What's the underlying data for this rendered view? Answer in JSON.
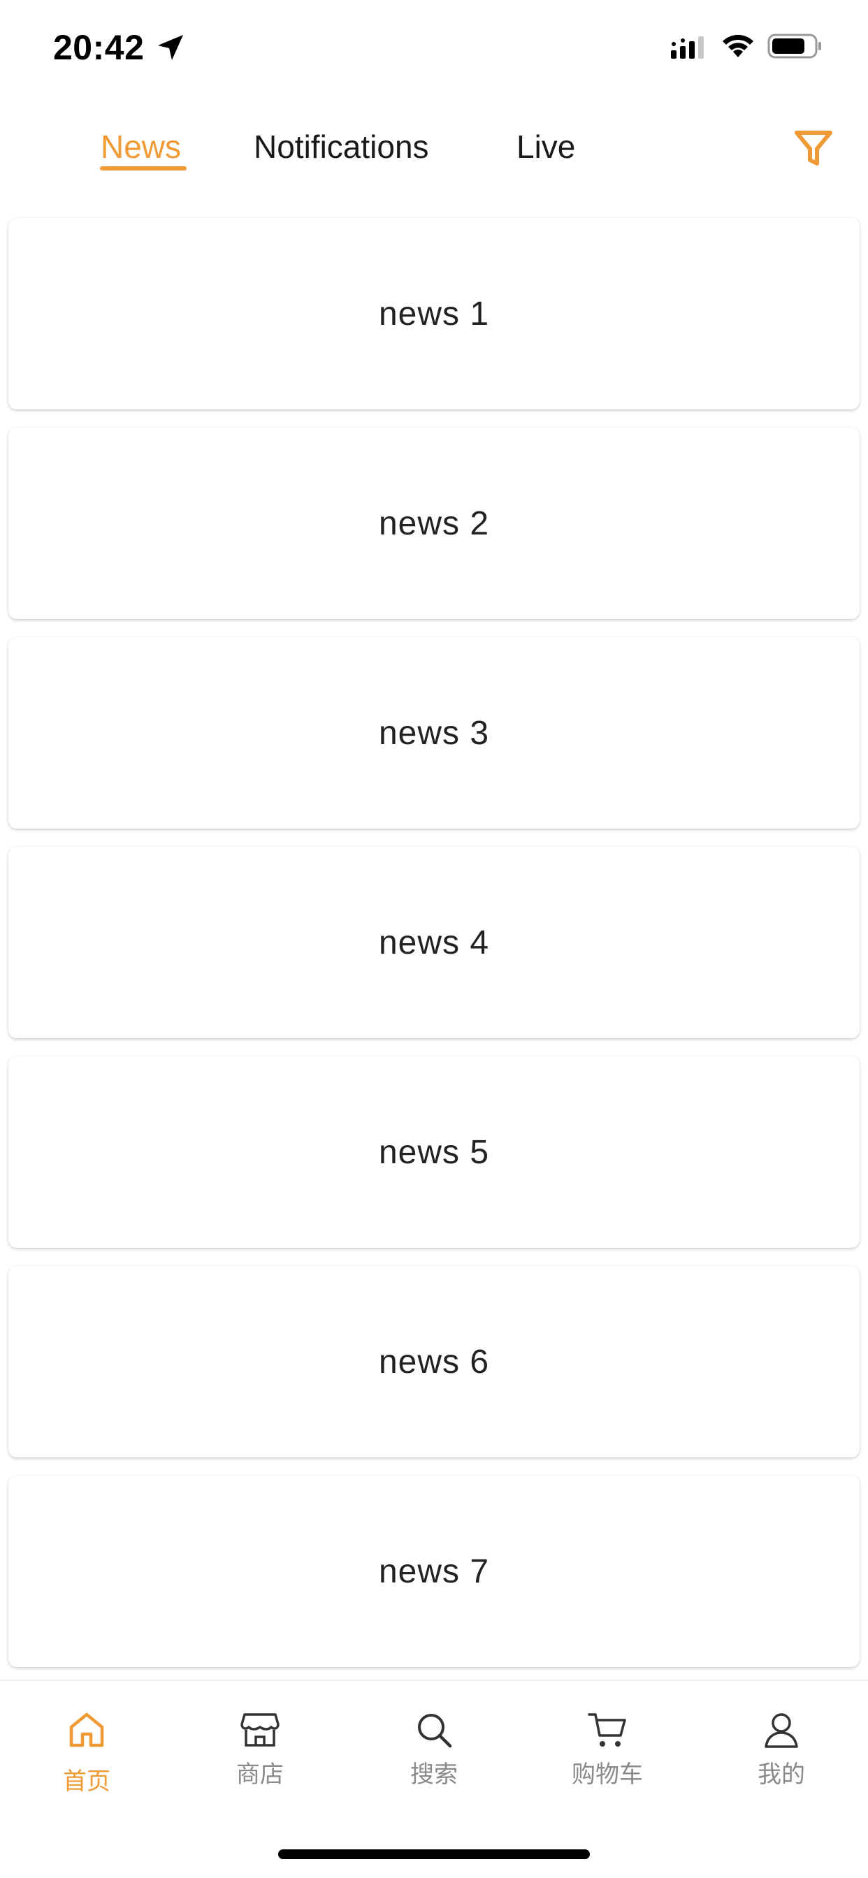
{
  "status_bar": {
    "time": "20:42",
    "icons": [
      "location-arrow-icon",
      "cellular-signal-icon",
      "wifi-icon",
      "battery-icon"
    ]
  },
  "tabs": [
    {
      "label": "News",
      "active": true
    },
    {
      "label": "Notifications",
      "active": false
    },
    {
      "label": "Live",
      "active": false
    }
  ],
  "filter_icon": "filter-icon",
  "news": [
    {
      "title": "news 1"
    },
    {
      "title": "news 2"
    },
    {
      "title": "news 3"
    },
    {
      "title": "news 4"
    },
    {
      "title": "news 5"
    },
    {
      "title": "news 6"
    },
    {
      "title": "news 7"
    }
  ],
  "bottom_nav": [
    {
      "label": "首页",
      "icon": "home-icon",
      "active": true
    },
    {
      "label": "商店",
      "icon": "store-icon",
      "active": false
    },
    {
      "label": "搜索",
      "icon": "search-icon",
      "active": false
    },
    {
      "label": "购物车",
      "icon": "cart-icon",
      "active": false
    },
    {
      "label": "我的",
      "icon": "profile-icon",
      "active": false
    }
  ],
  "colors": {
    "accent": "#EF9A34",
    "text": "#1a1a1a",
    "nav_inactive": "#8a8a8a",
    "background": "#ffffff"
  }
}
